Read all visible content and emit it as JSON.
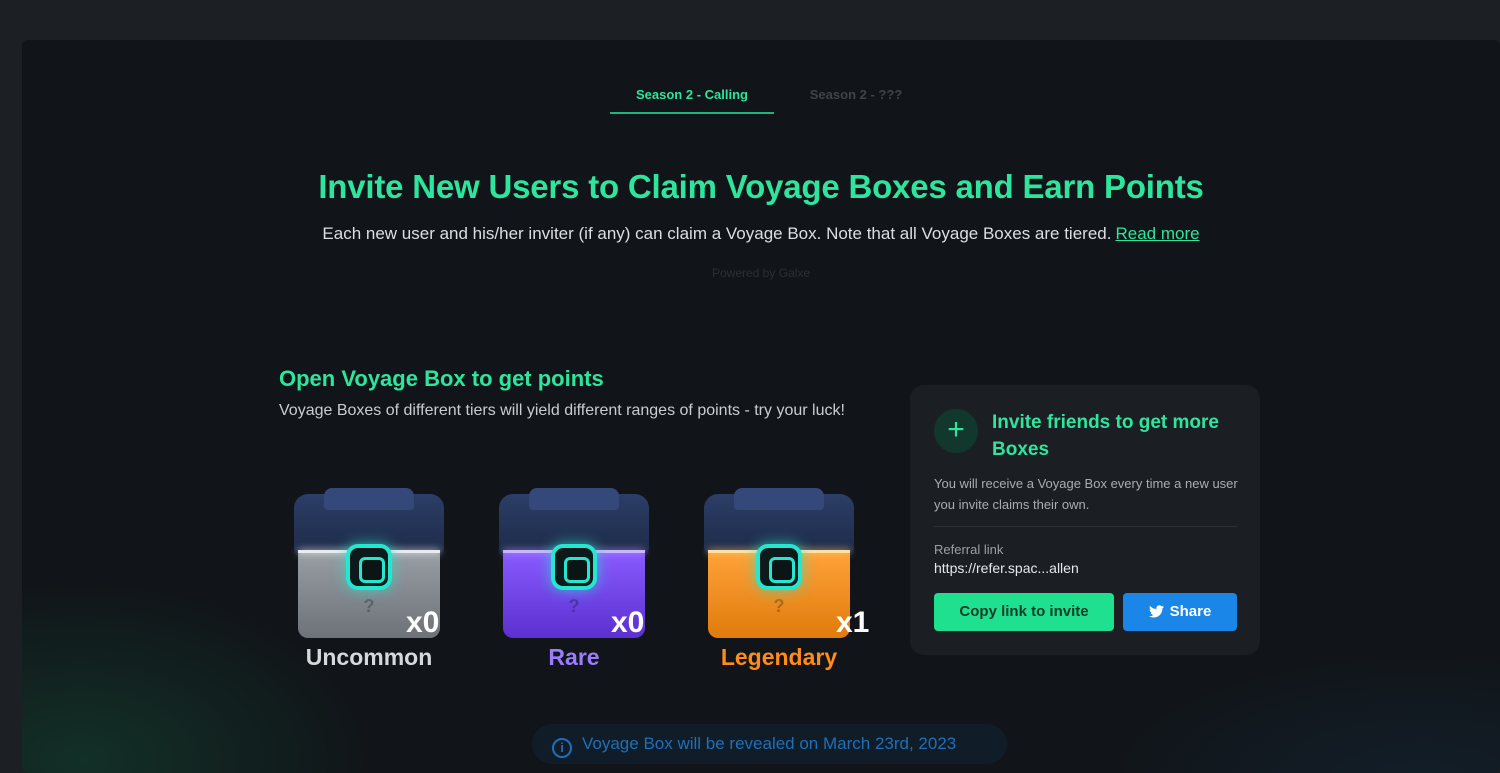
{
  "tabs": [
    {
      "label": "Season 2 - Calling",
      "active": true
    },
    {
      "label": "Season 2 - ???",
      "active": false
    }
  ],
  "hero": {
    "title": "Invite New Users to Claim Voyage Boxes and Earn Points",
    "subtitle": "Each new user and his/her inviter (if any) can claim a Voyage Box. Note that all Voyage Boxes are tiered.",
    "read_more": "Read more",
    "powered_by": "Powered by Galxe"
  },
  "boxes_section": {
    "title": "Open Voyage Box to get points",
    "description": "Voyage Boxes of different tiers will yield different ranges of points - try your luck!",
    "boxes": [
      {
        "tier": "Uncommon",
        "count": "x0",
        "color": "#d6d9dc",
        "body_color": "#8a8f96"
      },
      {
        "tier": "Rare",
        "count": "x0",
        "color": "#9b7cff",
        "body_color": "#7a4cf0"
      },
      {
        "tier": "Legendary",
        "count": "x1",
        "color": "#ff8c1a",
        "body_color": "#f7931e"
      }
    ]
  },
  "invite_card": {
    "plus_icon": "+",
    "title": "Invite friends to get more Boxes",
    "description": "You will receive a Voyage Box every time a new user you invite claims their own.",
    "referral_label": "Referral link",
    "referral_value": "https://refer.spac...allen",
    "copy_button": "Copy link to invite",
    "share_button": "Share",
    "accent": "#2ee59d",
    "twitter_color": "#1a86e8"
  },
  "notice": {
    "icon": "i",
    "text": "Voyage Box will be revealed on March 23rd, 2023"
  }
}
